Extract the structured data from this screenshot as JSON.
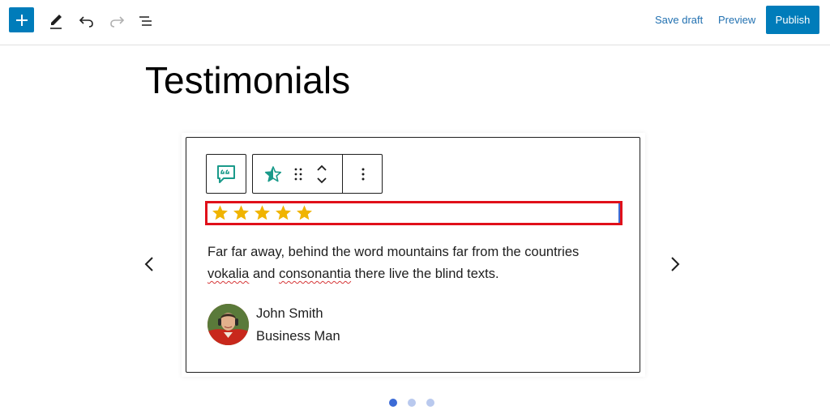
{
  "toolbar": {
    "add_icon": "plus-icon",
    "edit_icon": "pencil-icon",
    "undo_icon": "undo-icon",
    "redo_icon": "redo-icon",
    "list_view_icon": "list-view-icon",
    "save_draft_label": "Save draft",
    "preview_label": "Preview",
    "publish_label": "Publish",
    "accent_color": "#007cba"
  },
  "page": {
    "title": "Testimonials"
  },
  "block_toolbar": {
    "block_icon": "quote-bubble-icon",
    "rating_icon": "star-half-icon",
    "drag_icon": "drag-handle-icon",
    "move_icon": "chevron-up-down-icon",
    "more_icon": "more-vertical-icon"
  },
  "testimonial": {
    "rating": 5,
    "rating_max": 5,
    "star_color": "#f0b400",
    "quote_part1": "Far far away, behind the word mountains far from the countries ",
    "quote_misspelled1": "vokalia",
    "quote_part2": " and ",
    "quote_misspelled2": "consonantia",
    "quote_part3": " there live the blind texts.",
    "author_name": "John Smith",
    "author_role": "Business Man"
  },
  "carousel": {
    "prev_icon": "chevron-left-icon",
    "next_icon": "chevron-right-icon",
    "slides": 3,
    "active_slide": 1,
    "active_color": "#3b6bd6"
  },
  "highlight_color": "#e0101a"
}
